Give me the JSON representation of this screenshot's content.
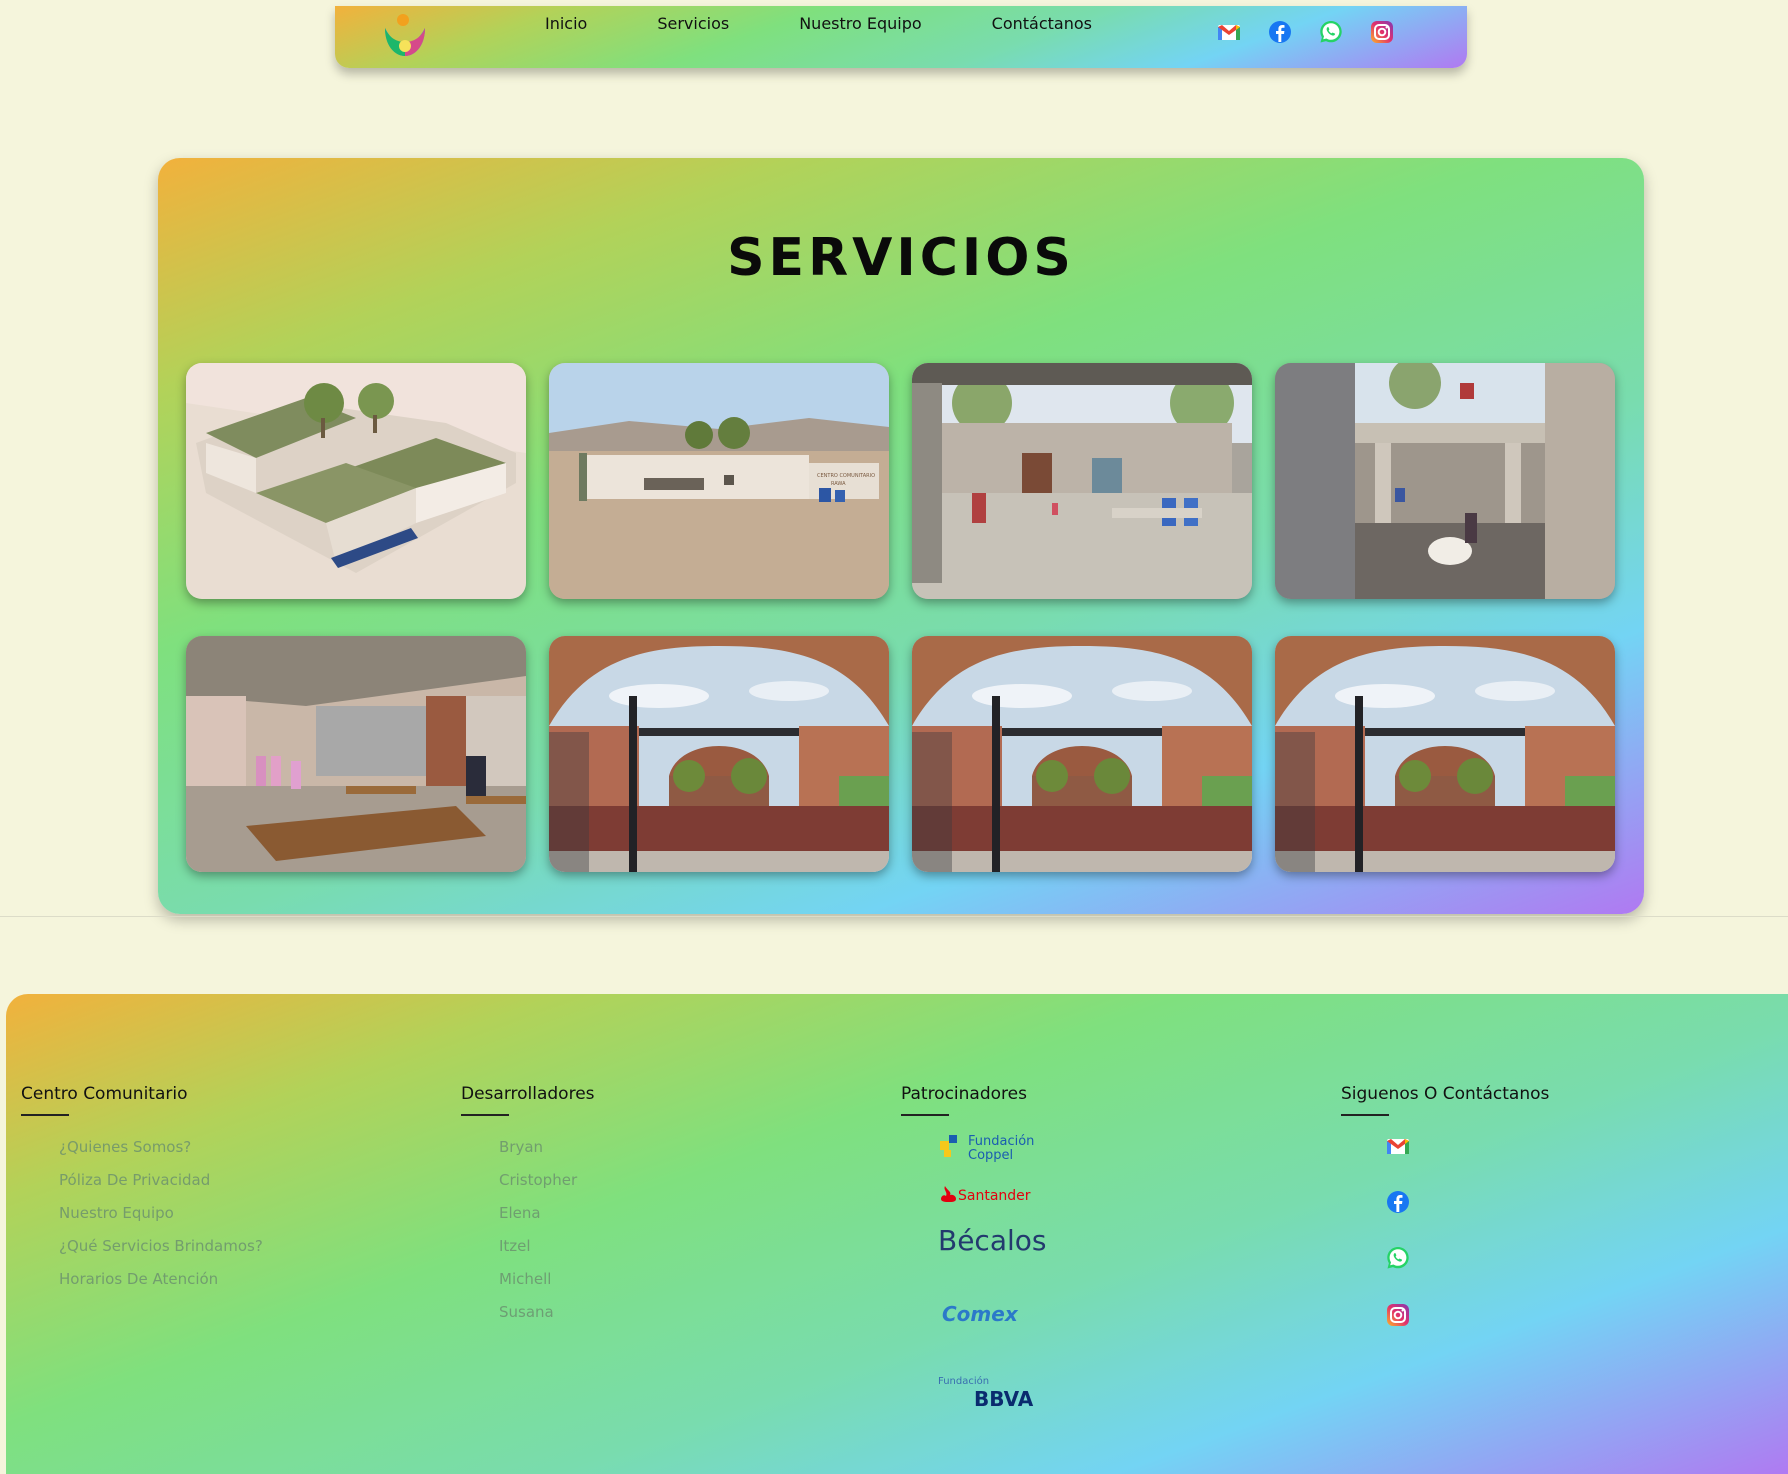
{
  "nav": {
    "logo": "community-center-logo",
    "links": [
      "Inicio",
      "Servicios",
      "Nuestro Equipo",
      "Contáctanos"
    ],
    "social_icons": [
      "gmail-icon",
      "facebook-icon",
      "whatsapp-icon",
      "instagram-icon"
    ]
  },
  "services": {
    "title": "SERVICIOS",
    "photos": [
      "aerial-rendering-building-with-green-roofs",
      "desert-building-with-sign",
      "courtyard-with-people-and-trees",
      "glass-corridor-courtyard-with-dog",
      "interior-dining-room-with-tables",
      "brick-vault-courtyard",
      "brick-vault-courtyard",
      "brick-vault-courtyard"
    ],
    "building_sign": "CENTRO COMUNITARIO RAWA"
  },
  "footer": {
    "col1": {
      "heading": "Centro Comunitario",
      "items": [
        "¿Quienes Somos?",
        "Póliza De Privacidad",
        "Nuestro Equipo",
        "¿Qué Servicios Brindamos?",
        "Horarios De Atención"
      ]
    },
    "col2": {
      "heading": "Desarrolladores",
      "items": [
        "Bryan",
        "Cristopher",
        "Elena",
        "Itzel",
        "Michell",
        "Susana"
      ]
    },
    "col3": {
      "heading": "Patrocinadores",
      "sponsors": {
        "coppel": "Fundación Coppel",
        "coppel_line1": "Fundación",
        "coppel_line2": "Coppel",
        "santander": "Santander",
        "becalos": "Bécalos",
        "comex": "Comex",
        "bbva_top": "Fundación",
        "bbva": "BBVA"
      }
    },
    "col4": {
      "heading": "Siguenos O Contáctanos",
      "social_icons": [
        "gmail-icon",
        "facebook-icon",
        "whatsapp-icon",
        "instagram-icon"
      ]
    }
  },
  "colors": {
    "background": "#f5f5dc",
    "gradient": [
      "#f2b13c",
      "#7fe07e",
      "#73d4f4",
      "#b079f2"
    ]
  }
}
